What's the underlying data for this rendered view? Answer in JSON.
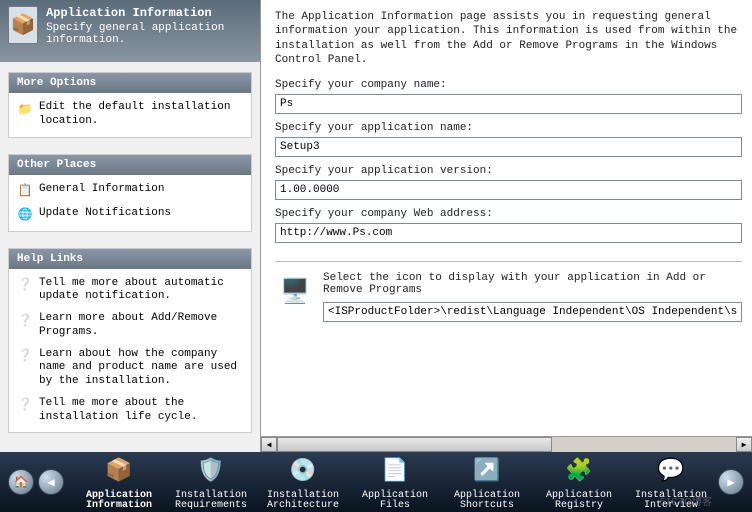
{
  "header": {
    "title": "Application Information",
    "subtitle": "Specify general application information."
  },
  "sidebar": {
    "more_options": {
      "title": "More Options",
      "items": [
        {
          "label": "Edit the default installation location."
        }
      ]
    },
    "other_places": {
      "title": "Other Places",
      "items": [
        {
          "label": "General Information"
        },
        {
          "label": "Update Notifications"
        }
      ]
    },
    "help_links": {
      "title": "Help Links",
      "items": [
        {
          "label": "Tell me more about automatic update notification."
        },
        {
          "label": "Learn more about Add/Remove Programs."
        },
        {
          "label": "Learn about how the company name and product name are used by the installation."
        },
        {
          "label": "Tell me more about the installation life cycle."
        }
      ]
    }
  },
  "main": {
    "intro": "The Application Information page assists you in requesting general information your application. This information is used from within the installation as well from the Add or Remove Programs in the Windows Control Panel.",
    "fields": {
      "company_label": "Specify your company name:",
      "company_value": "Ps",
      "appname_label": "Specify your application name:",
      "appname_value": "Setup3",
      "version_label": "Specify your application version:",
      "version_value": "1.00.0000",
      "web_label": "Specify your company Web address:",
      "web_value": "http://www.Ps.com"
    },
    "icon_section": {
      "text": "Select the icon to display with your application in Add or Remove Programs",
      "path": "<ISProductFolder>\\redist\\Language Independent\\OS Independent\\setupicon."
    }
  },
  "footer": {
    "steps": [
      {
        "label": "Application Information"
      },
      {
        "label": "Installation Requirements"
      },
      {
        "label": "Installation Architecture"
      },
      {
        "label": "Application Files"
      },
      {
        "label": "Application Shortcuts"
      },
      {
        "label": "Application Registry"
      },
      {
        "label": "Installation Interview"
      }
    ],
    "watermark": "51CTO博客"
  }
}
